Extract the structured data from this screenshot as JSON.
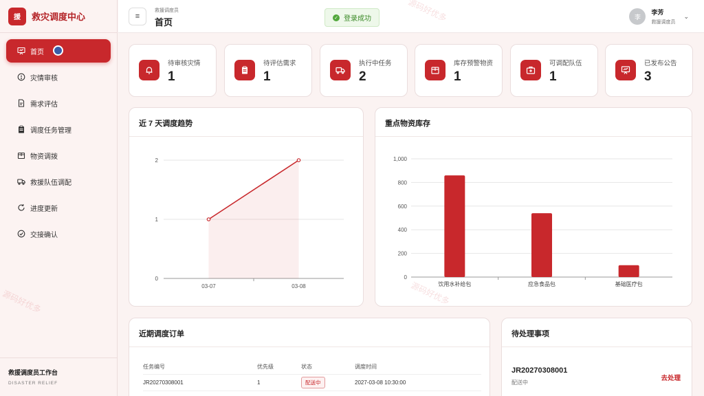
{
  "brand": {
    "logo_text": "援",
    "title": "救灾调度中心"
  },
  "sidebar": {
    "items": [
      {
        "label": "首页",
        "icon": "dashboard-icon",
        "active": true
      },
      {
        "label": "灾情审核",
        "icon": "info-circle-icon"
      },
      {
        "label": "需求评估",
        "icon": "document-icon"
      },
      {
        "label": "调度任务管理",
        "icon": "clipboard-icon"
      },
      {
        "label": "物资调拨",
        "icon": "box-icon"
      },
      {
        "label": "救援队伍调配",
        "icon": "truck-icon"
      },
      {
        "label": "进度更新",
        "icon": "refresh-icon"
      },
      {
        "label": "交接确认",
        "icon": "check-circle-icon"
      }
    ],
    "footer_title": "救援调度员工作台",
    "footer_sub": "DISASTER RELIEF"
  },
  "header": {
    "role_small": "救援调度员",
    "page_title": "首页",
    "toast": "登录成功",
    "user_avatar": "李",
    "user_name": "李芳",
    "user_role": "救援调度员"
  },
  "stats": [
    {
      "label": "待审核灾情",
      "value": "1",
      "icon": "bell-icon"
    },
    {
      "label": "待评估需求",
      "value": "1",
      "icon": "clipboard-icon"
    },
    {
      "label": "执行中任务",
      "value": "2",
      "icon": "truck-icon"
    },
    {
      "label": "库存预警物资",
      "value": "1",
      "icon": "box-icon"
    },
    {
      "label": "可调配队伍",
      "value": "1",
      "icon": "medkit-icon"
    },
    {
      "label": "已发布公告",
      "value": "3",
      "icon": "presentation-icon"
    }
  ],
  "trend_panel": {
    "title": "近 7 天调度趋势"
  },
  "stock_panel": {
    "title": "重点物资库存"
  },
  "orders_panel": {
    "title": "近期调度订单",
    "columns": [
      "任务编号",
      "优先级",
      "状态",
      "调度时间"
    ],
    "rows": [
      {
        "id": "JR20270308001",
        "priority": "1",
        "status": "配送中",
        "time": "2027-03-08 10:30:00"
      }
    ]
  },
  "todo_panel": {
    "title": "待处理事项",
    "item_id": "JR20270308001",
    "item_status": "配送中",
    "item_action": "去处理"
  },
  "watermark_text": "源码好优多",
  "chart_data": [
    {
      "type": "area",
      "title": "近 7 天调度趋势",
      "x": [
        "03-07",
        "03-08"
      ],
      "series": [
        {
          "values": [
            1,
            2
          ]
        }
      ],
      "ylim": [
        0,
        2
      ],
      "yticks": [
        0,
        1,
        2
      ],
      "grid": true,
      "color": "#c8282c"
    },
    {
      "type": "bar",
      "title": "重点物资库存",
      "categories": [
        "饮用水补给包",
        "应急食品包",
        "基础医疗包"
      ],
      "values": [
        860,
        540,
        100
      ],
      "ylim": [
        0,
        1000
      ],
      "yticks": [
        0,
        200,
        400,
        600,
        800,
        1000
      ],
      "ytick_labels": [
        "0",
        "200",
        "400",
        "600",
        "800",
        "1,000"
      ],
      "grid": true,
      "color": "#c8282c"
    }
  ]
}
